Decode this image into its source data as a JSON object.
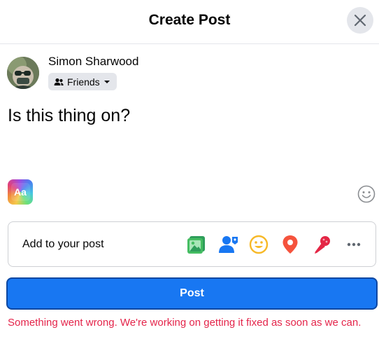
{
  "dialog": {
    "title": "Create Post"
  },
  "user": {
    "name": "Simon Sharwood",
    "audience": "Friends"
  },
  "post": {
    "text": "Is this thing on?"
  },
  "composer": {
    "text_format_label": "Aa",
    "add_to_post_label": "Add to your post",
    "add_icons": [
      "photo-video-icon",
      "tag-people-icon",
      "feeling-icon",
      "check-in-icon",
      "live-video-icon",
      "more-icon"
    ]
  },
  "actions": {
    "post_label": "Post"
  },
  "error": {
    "message": "Something went wrong. We're working on getting it fixed as soon as we can."
  },
  "colors": {
    "primary": "#1877f2",
    "error": "#e4244a",
    "button_gray": "#e4e6eb"
  }
}
